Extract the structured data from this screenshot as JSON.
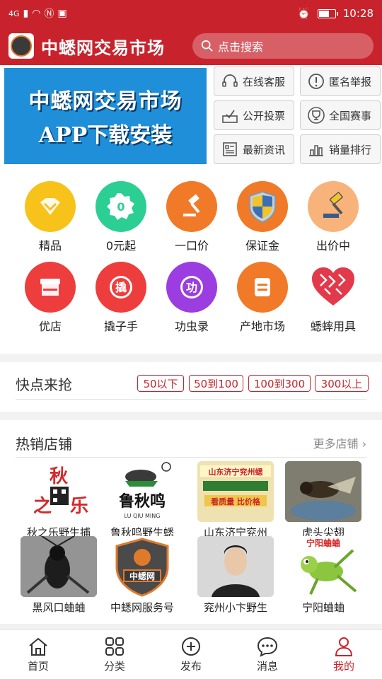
{
  "status": {
    "time": "10:28",
    "network": "4G",
    "battery_level": 0.7
  },
  "header": {
    "app_title": "中蟋网交易市场",
    "search_placeholder": "点击搜索"
  },
  "banner": {
    "line1": "中蟋网交易市场",
    "line2": "APP下载安装",
    "bg": "#1e8fd8"
  },
  "quick_buttons": [
    {
      "label": "在线客服",
      "icon": "headset-icon"
    },
    {
      "label": "匿名举报",
      "icon": "alert-icon"
    },
    {
      "label": "公开投票",
      "icon": "vote-icon"
    },
    {
      "label": "全国赛事",
      "icon": "trophy-icon"
    },
    {
      "label": "最新资讯",
      "icon": "news-icon"
    },
    {
      "label": "销量排行",
      "icon": "ranking-icon"
    }
  ],
  "categories": [
    {
      "label": "精品",
      "icon": "diamond-icon",
      "color": "#f7c21a"
    },
    {
      "label": "0元起",
      "icon": "zero-badge-icon",
      "color": "#2bcf94"
    },
    {
      "label": "一口价",
      "icon": "hammer-icon",
      "color": "#f07a28"
    },
    {
      "label": "保证金",
      "icon": "shield-icon",
      "color": "#f07a28"
    },
    {
      "label": "出价中",
      "icon": "auction-icon",
      "color": "#f7b37a"
    },
    {
      "label": "优店",
      "icon": "store-icon",
      "color": "#ee3d3d"
    },
    {
      "label": "撬子手",
      "icon": "qiao-badge-icon",
      "color": "#ee3d3d"
    },
    {
      "label": "功虫录",
      "icon": "gong-badge-icon",
      "color": "#9b3de0"
    },
    {
      "label": "产地市场",
      "icon": "list-icon",
      "color": "#f07a28"
    },
    {
      "label": "蟋蟀用具",
      "icon": "heart-pattern-icon",
      "color": "#e23a4a"
    }
  ],
  "quick_grab": {
    "title": "快点来抢",
    "chips": [
      "50以下",
      "50到100",
      "100到300",
      "300以上"
    ]
  },
  "hot_shops": {
    "title": "热销店铺",
    "more": "更多店铺",
    "shops": [
      {
        "name": "秋之乐野生捕",
        "thumb_text": "秋之乐"
      },
      {
        "name": "鲁秋鸣野生蟋",
        "thumb_text": "鲁秋鸣"
      },
      {
        "name": "山东济宁兖州",
        "thumb_text": "山东济宁兖州蟋蟀"
      },
      {
        "name": "虎头尖翅",
        "thumb_text": ""
      },
      {
        "name": "黑风口蛐蛐",
        "thumb_text": ""
      },
      {
        "name": "中蟋网服务号",
        "thumb_text": "中蟋网"
      },
      {
        "name": "兖州小卞野生",
        "thumb_text": ""
      },
      {
        "name": "宁阳蛐蛐",
        "thumb_text": "宁阳蛐蛐"
      }
    ]
  },
  "tabs": [
    {
      "label": "首页",
      "icon": "home-icon"
    },
    {
      "label": "分类",
      "icon": "grid-icon"
    },
    {
      "label": "发布",
      "icon": "plus-circle-icon"
    },
    {
      "label": "消息",
      "icon": "chat-icon"
    },
    {
      "label": "我的",
      "icon": "user-icon",
      "active": true
    }
  ],
  "colors": {
    "brand": "#c8232c",
    "background": "#f2f2f2"
  }
}
